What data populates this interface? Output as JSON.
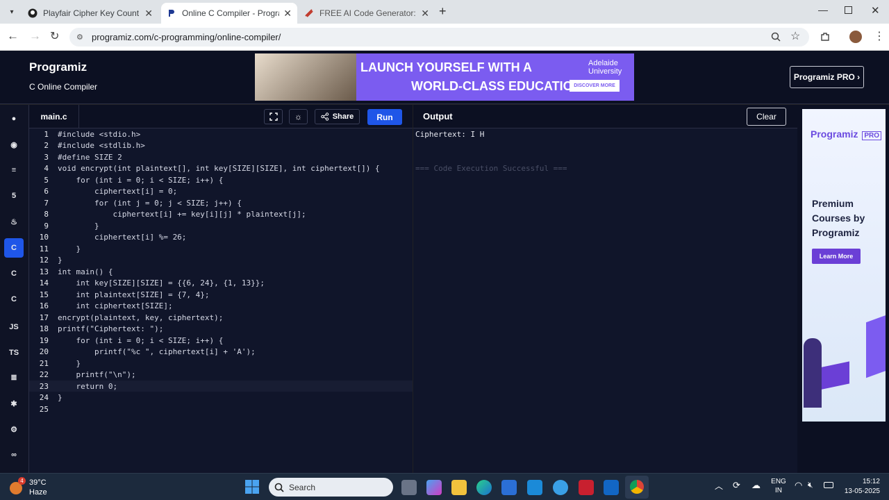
{
  "browser": {
    "tabs": [
      {
        "title": "Playfair Cipher Key Count",
        "active": false
      },
      {
        "title": "Online C Compiler - Programiz",
        "active": true
      },
      {
        "title": "FREE AI Code Generator: Gener",
        "active": false
      }
    ],
    "url": "programiz.com/c-programming/online-compiler/"
  },
  "header": {
    "brand": "Programiz",
    "subtitle": "C Online Compiler",
    "pro_button": "Programiz PRO ›",
    "ad": {
      "line1": "LAUNCH YOURSELF WITH A",
      "line2": "WORLD-CLASS EDUCATION",
      "university": "Adelaide University",
      "cta": "DISCOVER MORE"
    }
  },
  "sidebar": {
    "items": [
      "python",
      "r",
      "sql",
      "html",
      "java",
      "c",
      "cpp",
      "csharp",
      "JS",
      "TS",
      "go",
      "php",
      "rust",
      "swift"
    ]
  },
  "editor": {
    "filename": "main.c",
    "share_label": "Share",
    "run_label": "Run",
    "lines": [
      "#include <stdio.h>",
      "#include <stdlib.h>",
      "#define SIZE 2",
      "void encrypt(int plaintext[], int key[SIZE][SIZE], int ciphertext[]) {",
      "    for (int i = 0; i < SIZE; i++) {",
      "        ciphertext[i] = 0;",
      "        for (int j = 0; j < SIZE; j++) {",
      "            ciphertext[i] += key[i][j] * plaintext[j];",
      "        }",
      "        ciphertext[i] %= 26;",
      "    }",
      "}",
      "int main() {",
      "    int key[SIZE][SIZE] = {{6, 24}, {1, 13}};",
      "    int plaintext[SIZE] = {7, 4};",
      "    int ciphertext[SIZE];",
      "encrypt(plaintext, key, ciphertext);",
      "printf(\"Ciphertext: \");",
      "    for (int i = 0; i < SIZE; i++) {",
      "        printf(\"%c \", ciphertext[i] + 'A');",
      "    }",
      "    printf(\"\\n\");",
      "    return 0;",
      "}",
      ""
    ]
  },
  "output": {
    "title": "Output",
    "clear_label": "Clear",
    "line1": "Ciphertext: I H",
    "status": "=== Code Execution Successful ==="
  },
  "side_ad": {
    "brand": "Programiz",
    "pro_badge": "PRO",
    "headline": "Premium Courses by Programiz",
    "cta": "Learn More"
  },
  "taskbar": {
    "weather_temp": "39°C",
    "weather_desc": "Haze",
    "weather_badge": "4",
    "search_placeholder": "Search",
    "lang1": "ENG",
    "lang2": "IN",
    "time": "15:12",
    "date": "13-05-2025"
  },
  "colors": {
    "run": "#1f56e8",
    "accent_purple": "#7b5cf0"
  }
}
